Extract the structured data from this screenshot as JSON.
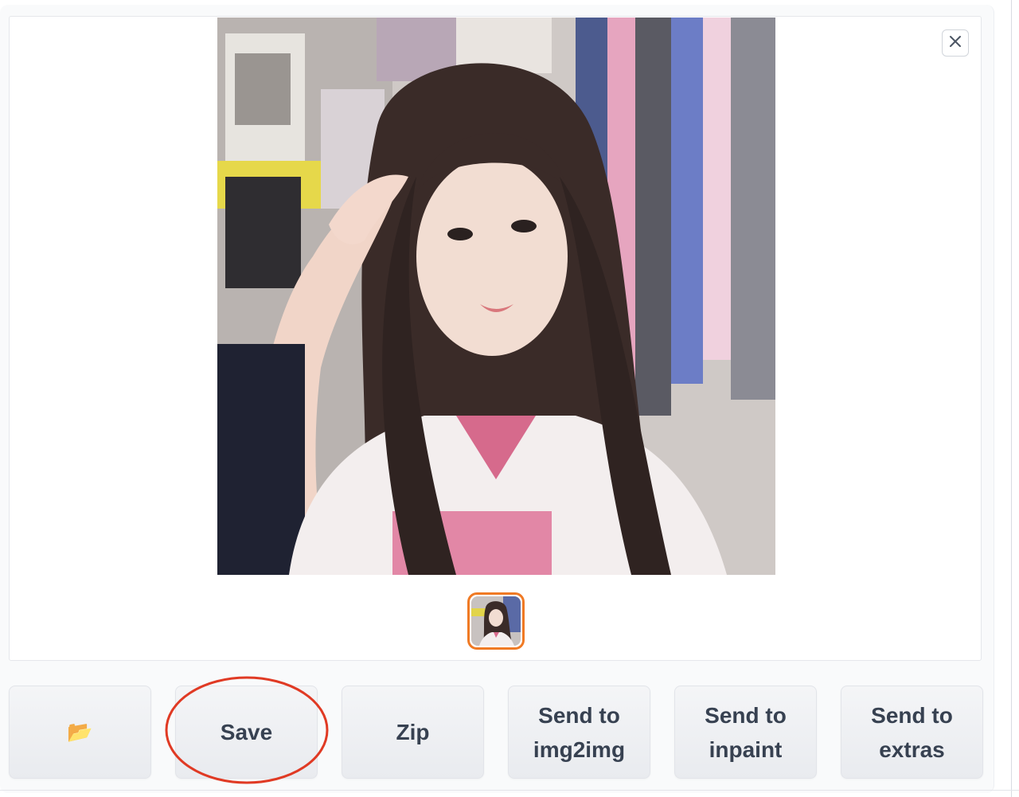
{
  "gallery": {
    "close_label": "Close",
    "preview_alt": "Generated image preview",
    "thumbnail_selected": true
  },
  "toolbar": {
    "open_folder_icon": "📂",
    "save_label": "Save",
    "zip_label": "Zip",
    "send_img2img_line1": "Send to",
    "send_img2img_line2": "img2img",
    "send_inpaint_line1": "Send to",
    "send_inpaint_line2": "inpaint",
    "send_extras_line1": "Send to",
    "send_extras_line2": "extras"
  },
  "colors": {
    "thumbnail_border": "#f07a24",
    "annotation_circle": "#e03a24",
    "button_text": "#374151"
  },
  "icons": {
    "close": "close-icon",
    "folder": "folder-icon"
  }
}
